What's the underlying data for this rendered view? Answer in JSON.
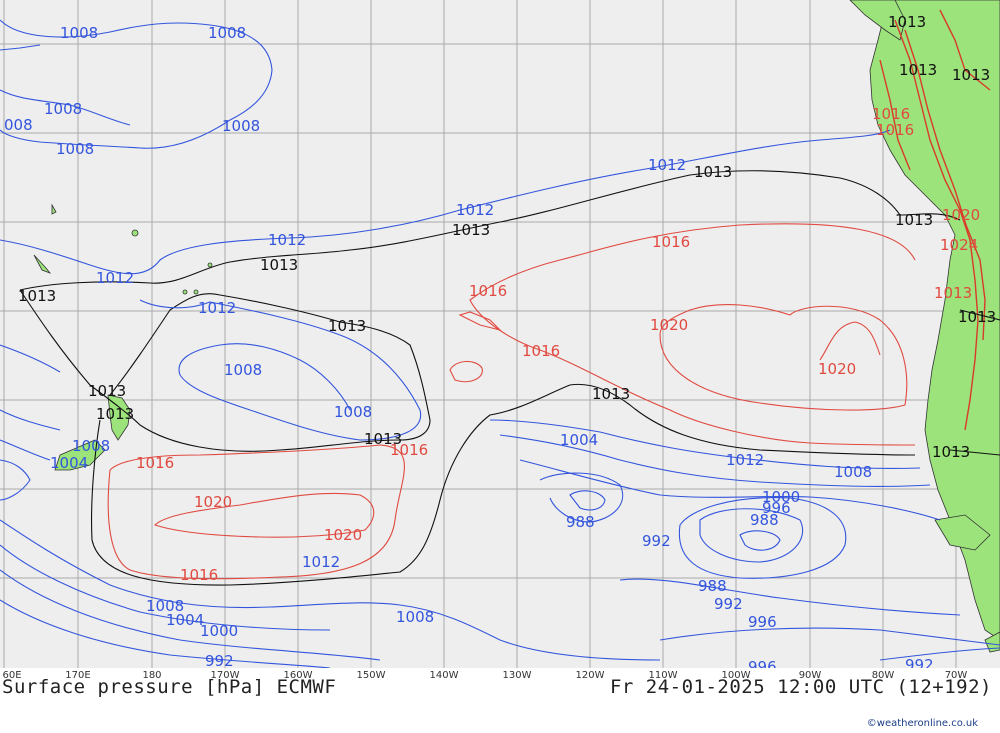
{
  "title": "Surface pressure [hPa] ECMWF",
  "valid_time": "Fr 24-01-2025 12:00 UTC (12+192)",
  "credit": "©weatheronline.co.uk",
  "colors": {
    "ocean": "#eeeeee",
    "land": "#9be37a",
    "mountains": "#d93a2a",
    "grid": "#aaaaaa",
    "low_isobar": "#3355dd",
    "standard_isobar": "#111111",
    "high_isobar": "#e04a40"
  },
  "longitude_labels": [
    "60E",
    "170E",
    "180",
    "170W",
    "160W",
    "150W",
    "140W",
    "130W",
    "120W",
    "110W",
    "100W",
    "90W",
    "80W",
    "70W"
  ],
  "isobar_labels": [
    {
      "text": "1008",
      "kind": "low"
    },
    {
      "text": "1008",
      "kind": "low"
    },
    {
      "text": "1008",
      "kind": "low"
    },
    {
      "text": "008",
      "kind": "low"
    },
    {
      "text": "1008",
      "kind": "low"
    },
    {
      "text": "1008",
      "kind": "low"
    },
    {
      "text": "1013",
      "kind": "standard"
    },
    {
      "text": "1013",
      "kind": "standard"
    },
    {
      "text": "1013",
      "kind": "standard"
    },
    {
      "text": "1016",
      "kind": "high"
    },
    {
      "text": "1016",
      "kind": "high"
    },
    {
      "text": "1013",
      "kind": "standard"
    },
    {
      "text": "1020",
      "kind": "high"
    },
    {
      "text": "1024",
      "kind": "high"
    },
    {
      "text": "1012",
      "kind": "low"
    },
    {
      "text": "1013",
      "kind": "standard"
    },
    {
      "text": "1012",
      "kind": "low"
    },
    {
      "text": "1013",
      "kind": "standard"
    },
    {
      "text": "1016",
      "kind": "high"
    },
    {
      "text": "1012",
      "kind": "low"
    },
    {
      "text": "1013",
      "kind": "standard"
    },
    {
      "text": "1016",
      "kind": "high"
    },
    {
      "text": "1012",
      "kind": "low"
    },
    {
      "text": "1013",
      "kind": "standard"
    },
    {
      "text": "1013",
      "kind": "standard"
    },
    {
      "text": "1012",
      "kind": "low"
    },
    {
      "text": "1013",
      "kind": "standard"
    },
    {
      "text": "1020",
      "kind": "high"
    },
    {
      "text": "1016",
      "kind": "high"
    },
    {
      "text": "1020",
      "kind": "high"
    },
    {
      "text": "1013",
      "kind": "standard"
    },
    {
      "text": "1008",
      "kind": "low"
    },
    {
      "text": "1013",
      "kind": "standard"
    },
    {
      "text": "1013",
      "kind": "standard"
    },
    {
      "text": "1013",
      "kind": "standard"
    },
    {
      "text": "1008",
      "kind": "low"
    },
    {
      "text": "1008",
      "kind": "low"
    },
    {
      "text": "1013",
      "kind": "standard"
    },
    {
      "text": "1016",
      "kind": "high"
    },
    {
      "text": "1004",
      "kind": "low"
    },
    {
      "text": "1016",
      "kind": "high"
    },
    {
      "text": "1012",
      "kind": "low"
    },
    {
      "text": "1013",
      "kind": "standard"
    },
    {
      "text": "1008",
      "kind": "low"
    },
    {
      "text": "1004",
      "kind": "low"
    },
    {
      "text": "1000",
      "kind": "low"
    },
    {
      "text": "996",
      "kind": "low"
    },
    {
      "text": "988",
      "kind": "low"
    },
    {
      "text": "1020",
      "kind": "high"
    },
    {
      "text": "1020",
      "kind": "high"
    },
    {
      "text": "988",
      "kind": "low"
    },
    {
      "text": "992",
      "kind": "low"
    },
    {
      "text": "1016",
      "kind": "high"
    },
    {
      "text": "1012",
      "kind": "low"
    },
    {
      "text": "1008",
      "kind": "low"
    },
    {
      "text": "1004",
      "kind": "low"
    },
    {
      "text": "1000",
      "kind": "low"
    },
    {
      "text": "988",
      "kind": "low"
    },
    {
      "text": "992",
      "kind": "low"
    },
    {
      "text": "996",
      "kind": "low"
    },
    {
      "text": "1008",
      "kind": "low"
    },
    {
      "text": "992",
      "kind": "low"
    },
    {
      "text": "996",
      "kind": "low"
    },
    {
      "text": "992",
      "kind": "low"
    }
  ]
}
